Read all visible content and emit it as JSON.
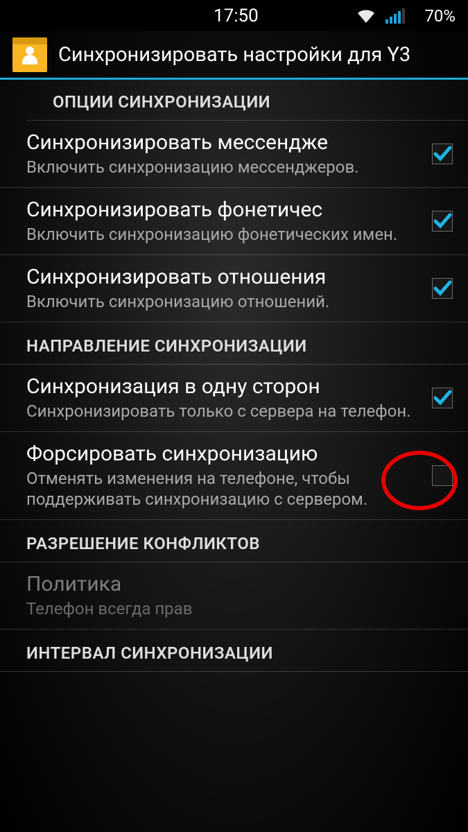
{
  "statusbar": {
    "time": "17:50",
    "battery": "70%"
  },
  "appbar": {
    "title": "Синхронизировать настройки для Y3"
  },
  "sections": {
    "sync_options": {
      "header": "ОПЦИИ СИНХРОНИЗАЦИИ"
    },
    "sync_direction": {
      "header": "НАПРАВЛЕНИЕ СИНХРОНИЗАЦИИ"
    },
    "conflict": {
      "header": "РАЗРЕШЕНИЕ КОНФЛИКТОВ"
    },
    "interval": {
      "header": "ИНТЕРВАЛ СИНХРОНИЗАЦИИ"
    }
  },
  "items": {
    "messengers": {
      "title": "Синхронизировать мессендже",
      "sub": "Включить синхронизацию мессенджеров.",
      "checked": true
    },
    "phonetic": {
      "title": "Синхронизировать фонетичес",
      "sub": "Включить синхронизацию фонетических имен.",
      "checked": true
    },
    "relations": {
      "title": "Синхронизировать отношения",
      "sub": "Включить синхронизацию отношений.",
      "checked": true
    },
    "oneway": {
      "title": "Синхронизация в одну сторон",
      "sub": "Синхронизировать только с сервера на телефон.",
      "checked": true
    },
    "force": {
      "title": "Форсировать синхронизацию",
      "sub": "Отменять изменения на телефоне, чтобы поддерживать синхронизацию с сервером.",
      "checked": false
    },
    "policy": {
      "title": "Политика",
      "sub": "Телефон всегда прав"
    }
  }
}
